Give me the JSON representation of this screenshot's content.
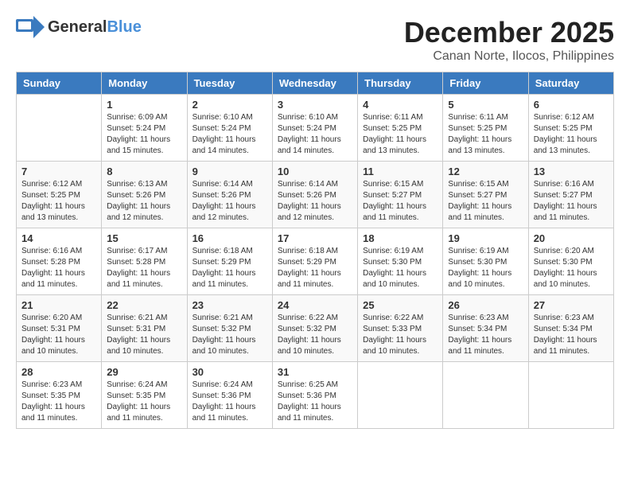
{
  "header": {
    "logo_general": "General",
    "logo_blue": "Blue",
    "month": "December 2025",
    "location": "Canan Norte, Ilocos, Philippines"
  },
  "weekdays": [
    "Sunday",
    "Monday",
    "Tuesday",
    "Wednesday",
    "Thursday",
    "Friday",
    "Saturday"
  ],
  "weeks": [
    [
      {
        "day": "",
        "sunrise": "",
        "sunset": "",
        "daylight": ""
      },
      {
        "day": "1",
        "sunrise": "Sunrise: 6:09 AM",
        "sunset": "Sunset: 5:24 PM",
        "daylight": "Daylight: 11 hours and 15 minutes."
      },
      {
        "day": "2",
        "sunrise": "Sunrise: 6:10 AM",
        "sunset": "Sunset: 5:24 PM",
        "daylight": "Daylight: 11 hours and 14 minutes."
      },
      {
        "day": "3",
        "sunrise": "Sunrise: 6:10 AM",
        "sunset": "Sunset: 5:24 PM",
        "daylight": "Daylight: 11 hours and 14 minutes."
      },
      {
        "day": "4",
        "sunrise": "Sunrise: 6:11 AM",
        "sunset": "Sunset: 5:25 PM",
        "daylight": "Daylight: 11 hours and 13 minutes."
      },
      {
        "day": "5",
        "sunrise": "Sunrise: 6:11 AM",
        "sunset": "Sunset: 5:25 PM",
        "daylight": "Daylight: 11 hours and 13 minutes."
      },
      {
        "day": "6",
        "sunrise": "Sunrise: 6:12 AM",
        "sunset": "Sunset: 5:25 PM",
        "daylight": "Daylight: 11 hours and 13 minutes."
      }
    ],
    [
      {
        "day": "7",
        "sunrise": "Sunrise: 6:12 AM",
        "sunset": "Sunset: 5:25 PM",
        "daylight": "Daylight: 11 hours and 13 minutes."
      },
      {
        "day": "8",
        "sunrise": "Sunrise: 6:13 AM",
        "sunset": "Sunset: 5:26 PM",
        "daylight": "Daylight: 11 hours and 12 minutes."
      },
      {
        "day": "9",
        "sunrise": "Sunrise: 6:14 AM",
        "sunset": "Sunset: 5:26 PM",
        "daylight": "Daylight: 11 hours and 12 minutes."
      },
      {
        "day": "10",
        "sunrise": "Sunrise: 6:14 AM",
        "sunset": "Sunset: 5:26 PM",
        "daylight": "Daylight: 11 hours and 12 minutes."
      },
      {
        "day": "11",
        "sunrise": "Sunrise: 6:15 AM",
        "sunset": "Sunset: 5:27 PM",
        "daylight": "Daylight: 11 hours and 11 minutes."
      },
      {
        "day": "12",
        "sunrise": "Sunrise: 6:15 AM",
        "sunset": "Sunset: 5:27 PM",
        "daylight": "Daylight: 11 hours and 11 minutes."
      },
      {
        "day": "13",
        "sunrise": "Sunrise: 6:16 AM",
        "sunset": "Sunset: 5:27 PM",
        "daylight": "Daylight: 11 hours and 11 minutes."
      }
    ],
    [
      {
        "day": "14",
        "sunrise": "Sunrise: 6:16 AM",
        "sunset": "Sunset: 5:28 PM",
        "daylight": "Daylight: 11 hours and 11 minutes."
      },
      {
        "day": "15",
        "sunrise": "Sunrise: 6:17 AM",
        "sunset": "Sunset: 5:28 PM",
        "daylight": "Daylight: 11 hours and 11 minutes."
      },
      {
        "day": "16",
        "sunrise": "Sunrise: 6:18 AM",
        "sunset": "Sunset: 5:29 PM",
        "daylight": "Daylight: 11 hours and 11 minutes."
      },
      {
        "day": "17",
        "sunrise": "Sunrise: 6:18 AM",
        "sunset": "Sunset: 5:29 PM",
        "daylight": "Daylight: 11 hours and 11 minutes."
      },
      {
        "day": "18",
        "sunrise": "Sunrise: 6:19 AM",
        "sunset": "Sunset: 5:30 PM",
        "daylight": "Daylight: 11 hours and 10 minutes."
      },
      {
        "day": "19",
        "sunrise": "Sunrise: 6:19 AM",
        "sunset": "Sunset: 5:30 PM",
        "daylight": "Daylight: 11 hours and 10 minutes."
      },
      {
        "day": "20",
        "sunrise": "Sunrise: 6:20 AM",
        "sunset": "Sunset: 5:30 PM",
        "daylight": "Daylight: 11 hours and 10 minutes."
      }
    ],
    [
      {
        "day": "21",
        "sunrise": "Sunrise: 6:20 AM",
        "sunset": "Sunset: 5:31 PM",
        "daylight": "Daylight: 11 hours and 10 minutes."
      },
      {
        "day": "22",
        "sunrise": "Sunrise: 6:21 AM",
        "sunset": "Sunset: 5:31 PM",
        "daylight": "Daylight: 11 hours and 10 minutes."
      },
      {
        "day": "23",
        "sunrise": "Sunrise: 6:21 AM",
        "sunset": "Sunset: 5:32 PM",
        "daylight": "Daylight: 11 hours and 10 minutes."
      },
      {
        "day": "24",
        "sunrise": "Sunrise: 6:22 AM",
        "sunset": "Sunset: 5:32 PM",
        "daylight": "Daylight: 11 hours and 10 minutes."
      },
      {
        "day": "25",
        "sunrise": "Sunrise: 6:22 AM",
        "sunset": "Sunset: 5:33 PM",
        "daylight": "Daylight: 11 hours and 10 minutes."
      },
      {
        "day": "26",
        "sunrise": "Sunrise: 6:23 AM",
        "sunset": "Sunset: 5:34 PM",
        "daylight": "Daylight: 11 hours and 11 minutes."
      },
      {
        "day": "27",
        "sunrise": "Sunrise: 6:23 AM",
        "sunset": "Sunset: 5:34 PM",
        "daylight": "Daylight: 11 hours and 11 minutes."
      }
    ],
    [
      {
        "day": "28",
        "sunrise": "Sunrise: 6:23 AM",
        "sunset": "Sunset: 5:35 PM",
        "daylight": "Daylight: 11 hours and 11 minutes."
      },
      {
        "day": "29",
        "sunrise": "Sunrise: 6:24 AM",
        "sunset": "Sunset: 5:35 PM",
        "daylight": "Daylight: 11 hours and 11 minutes."
      },
      {
        "day": "30",
        "sunrise": "Sunrise: 6:24 AM",
        "sunset": "Sunset: 5:36 PM",
        "daylight": "Daylight: 11 hours and 11 minutes."
      },
      {
        "day": "31",
        "sunrise": "Sunrise: 6:25 AM",
        "sunset": "Sunset: 5:36 PM",
        "daylight": "Daylight: 11 hours and 11 minutes."
      },
      {
        "day": "",
        "sunrise": "",
        "sunset": "",
        "daylight": ""
      },
      {
        "day": "",
        "sunrise": "",
        "sunset": "",
        "daylight": ""
      },
      {
        "day": "",
        "sunrise": "",
        "sunset": "",
        "daylight": ""
      }
    ]
  ]
}
